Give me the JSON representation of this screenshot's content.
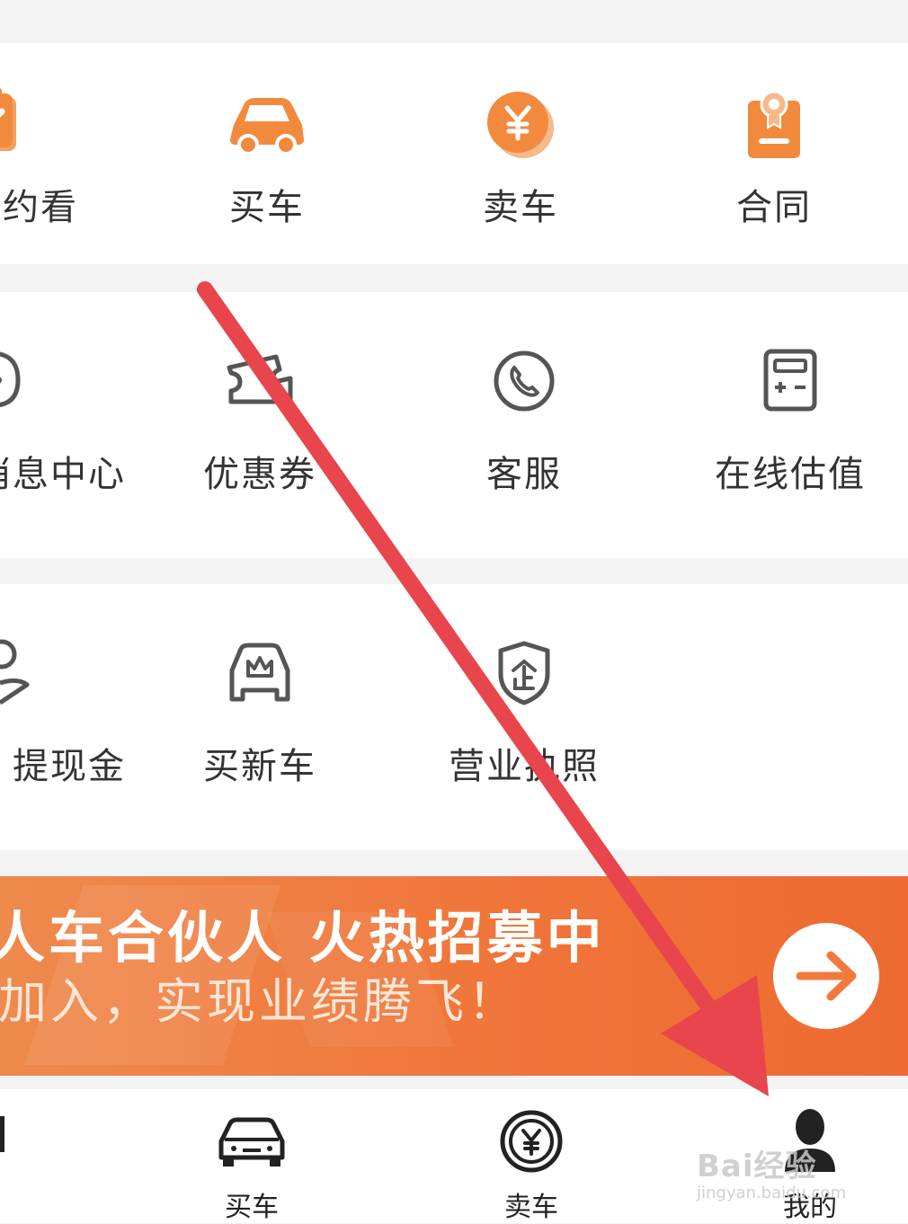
{
  "section1": {
    "items": [
      {
        "label": "约看",
        "icon": "calendar-check-icon"
      },
      {
        "label": "买车",
        "icon": "car-icon"
      },
      {
        "label": "卖车",
        "icon": "yuan-coin-icon"
      },
      {
        "label": "合同",
        "icon": "contract-icon"
      }
    ]
  },
  "section2": {
    "items": [
      {
        "label": "消息中心",
        "icon": "chat-bubble-icon"
      },
      {
        "label": "优惠券",
        "icon": "coupon-icon"
      },
      {
        "label": "客服",
        "icon": "phone-icon"
      },
      {
        "label": "在线估值",
        "icon": "calculator-icon"
      }
    ]
  },
  "section3": {
    "items": [
      {
        "label": "提现金",
        "icon": "cash-hand-icon"
      },
      {
        "label": "买新车",
        "icon": "new-car-crown-icon"
      },
      {
        "label": "营业执照",
        "icon": "enterprise-shield-icon"
      }
    ]
  },
  "banner": {
    "title": "人车合伙人 火热招募中",
    "subtitle": "加入，实现业绩腾飞！",
    "icon": "arrow-right-icon"
  },
  "tabbar": {
    "items": [
      {
        "label": "买车",
        "icon": "car-front-icon"
      },
      {
        "label": "卖车",
        "icon": "yuan-circle-icon"
      },
      {
        "label": "我的",
        "icon": "user-icon"
      }
    ]
  },
  "watermark": {
    "line1": "Bai经验",
    "line2": "jingyan.baidu.com"
  },
  "colors": {
    "accent": "#f07a3c",
    "arrow": "#e8454c"
  }
}
